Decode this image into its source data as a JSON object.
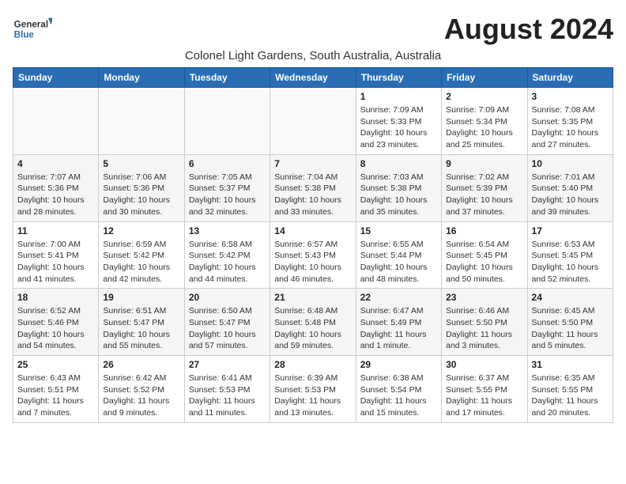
{
  "logo": {
    "general": "General",
    "blue": "Blue"
  },
  "title": "August 2024",
  "subtitle": "Colonel Light Gardens, South Australia, Australia",
  "days_of_week": [
    "Sunday",
    "Monday",
    "Tuesday",
    "Wednesday",
    "Thursday",
    "Friday",
    "Saturday"
  ],
  "weeks": [
    [
      {
        "day": "",
        "info": ""
      },
      {
        "day": "",
        "info": ""
      },
      {
        "day": "",
        "info": ""
      },
      {
        "day": "",
        "info": ""
      },
      {
        "day": "1",
        "sunrise": "7:09 AM",
        "sunset": "5:33 PM",
        "daylight": "10 hours and 23 minutes."
      },
      {
        "day": "2",
        "sunrise": "7:09 AM",
        "sunset": "5:34 PM",
        "daylight": "10 hours and 25 minutes."
      },
      {
        "day": "3",
        "sunrise": "7:08 AM",
        "sunset": "5:35 PM",
        "daylight": "10 hours and 27 minutes."
      }
    ],
    [
      {
        "day": "4",
        "sunrise": "7:07 AM",
        "sunset": "5:36 PM",
        "daylight": "10 hours and 28 minutes."
      },
      {
        "day": "5",
        "sunrise": "7:06 AM",
        "sunset": "5:36 PM",
        "daylight": "10 hours and 30 minutes."
      },
      {
        "day": "6",
        "sunrise": "7:05 AM",
        "sunset": "5:37 PM",
        "daylight": "10 hours and 32 minutes."
      },
      {
        "day": "7",
        "sunrise": "7:04 AM",
        "sunset": "5:38 PM",
        "daylight": "10 hours and 33 minutes."
      },
      {
        "day": "8",
        "sunrise": "7:03 AM",
        "sunset": "5:38 PM",
        "daylight": "10 hours and 35 minutes."
      },
      {
        "day": "9",
        "sunrise": "7:02 AM",
        "sunset": "5:39 PM",
        "daylight": "10 hours and 37 minutes."
      },
      {
        "day": "10",
        "sunrise": "7:01 AM",
        "sunset": "5:40 PM",
        "daylight": "10 hours and 39 minutes."
      }
    ],
    [
      {
        "day": "11",
        "sunrise": "7:00 AM",
        "sunset": "5:41 PM",
        "daylight": "10 hours and 41 minutes."
      },
      {
        "day": "12",
        "sunrise": "6:59 AM",
        "sunset": "5:42 PM",
        "daylight": "10 hours and 42 minutes."
      },
      {
        "day": "13",
        "sunrise": "6:58 AM",
        "sunset": "5:42 PM",
        "daylight": "10 hours and 44 minutes."
      },
      {
        "day": "14",
        "sunrise": "6:57 AM",
        "sunset": "5:43 PM",
        "daylight": "10 hours and 46 minutes."
      },
      {
        "day": "15",
        "sunrise": "6:55 AM",
        "sunset": "5:44 PM",
        "daylight": "10 hours and 48 minutes."
      },
      {
        "day": "16",
        "sunrise": "6:54 AM",
        "sunset": "5:45 PM",
        "daylight": "10 hours and 50 minutes."
      },
      {
        "day": "17",
        "sunrise": "6:53 AM",
        "sunset": "5:45 PM",
        "daylight": "10 hours and 52 minutes."
      }
    ],
    [
      {
        "day": "18",
        "sunrise": "6:52 AM",
        "sunset": "5:46 PM",
        "daylight": "10 hours and 54 minutes."
      },
      {
        "day": "19",
        "sunrise": "6:51 AM",
        "sunset": "5:47 PM",
        "daylight": "10 hours and 55 minutes."
      },
      {
        "day": "20",
        "sunrise": "6:50 AM",
        "sunset": "5:47 PM",
        "daylight": "10 hours and 57 minutes."
      },
      {
        "day": "21",
        "sunrise": "6:48 AM",
        "sunset": "5:48 PM",
        "daylight": "10 hours and 59 minutes."
      },
      {
        "day": "22",
        "sunrise": "6:47 AM",
        "sunset": "5:49 PM",
        "daylight": "11 hours and 1 minute."
      },
      {
        "day": "23",
        "sunrise": "6:46 AM",
        "sunset": "5:50 PM",
        "daylight": "11 hours and 3 minutes."
      },
      {
        "day": "24",
        "sunrise": "6:45 AM",
        "sunset": "5:50 PM",
        "daylight": "11 hours and 5 minutes."
      }
    ],
    [
      {
        "day": "25",
        "sunrise": "6:43 AM",
        "sunset": "5:51 PM",
        "daylight": "11 hours and 7 minutes."
      },
      {
        "day": "26",
        "sunrise": "6:42 AM",
        "sunset": "5:52 PM",
        "daylight": "11 hours and 9 minutes."
      },
      {
        "day": "27",
        "sunrise": "6:41 AM",
        "sunset": "5:53 PM",
        "daylight": "11 hours and 11 minutes."
      },
      {
        "day": "28",
        "sunrise": "6:39 AM",
        "sunset": "5:53 PM",
        "daylight": "11 hours and 13 minutes."
      },
      {
        "day": "29",
        "sunrise": "6:38 AM",
        "sunset": "5:54 PM",
        "daylight": "11 hours and 15 minutes."
      },
      {
        "day": "30",
        "sunrise": "6:37 AM",
        "sunset": "5:55 PM",
        "daylight": "11 hours and 17 minutes."
      },
      {
        "day": "31",
        "sunrise": "6:35 AM",
        "sunset": "5:55 PM",
        "daylight": "11 hours and 20 minutes."
      }
    ]
  ]
}
